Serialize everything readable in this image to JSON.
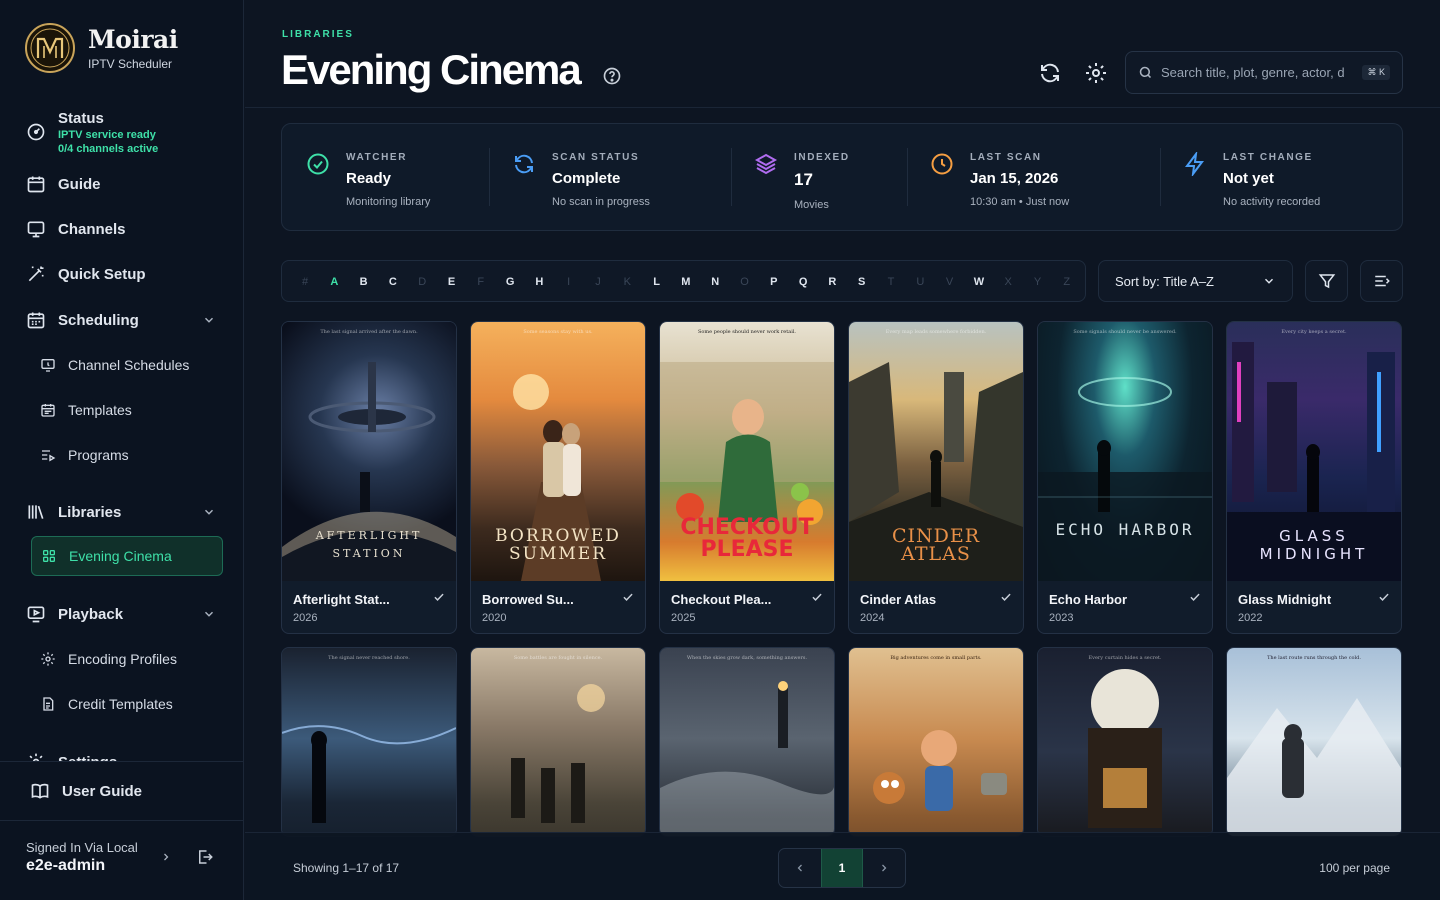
{
  "app": {
    "name": "Moirai",
    "subtitle": "IPTV Scheduler"
  },
  "colors": {
    "accent": "#3ee0a8",
    "background": "#0d1522",
    "sidebar": "#0b1320",
    "warning": "#f59e42",
    "purple": "#b06cf0",
    "blue": "#4a9df5"
  },
  "sidebar": {
    "status": {
      "title": "Status",
      "line1": "IPTV service ready",
      "line2": "0/4 channels active",
      "icon": "gauge-icon"
    },
    "guide": "Guide",
    "channels": "Channels",
    "quick_setup": "Quick Setup",
    "scheduling": "Scheduling",
    "channel_schedules": "Channel Schedules",
    "templates": "Templates",
    "programs": "Programs",
    "libraries": "Libraries",
    "evening_cinema": "Evening Cinema",
    "playback": "Playback",
    "encoding_profiles": "Encoding Profiles",
    "credit_templates": "Credit Templates",
    "settings": "Settings",
    "user_guide": "User Guide",
    "signed_label": "Signed In Via Local",
    "signed_user": "e2e-admin"
  },
  "header": {
    "eyebrow": "LIBRARIES",
    "title": "Evening Cinema",
    "search_placeholder": "Search title, plot, genre, actor, d",
    "search_shortcut": "⌘ K"
  },
  "stats": {
    "watcher": {
      "label": "WATCHER",
      "value": "Ready",
      "sub": "Monitoring library"
    },
    "scan": {
      "label": "SCAN STATUS",
      "value": "Complete",
      "sub": "No scan in progress"
    },
    "indexed": {
      "label": "INDEXED",
      "value": "17",
      "sub": "Movies"
    },
    "last_scan": {
      "label": "LAST SCAN",
      "value": "Jan 15, 2026",
      "sub": "10:30 am • Just now"
    },
    "last_change": {
      "label": "LAST CHANGE",
      "value": "Not yet",
      "sub": "No activity recorded"
    }
  },
  "alphabet": {
    "letters": [
      "#",
      "A",
      "B",
      "C",
      "D",
      "E",
      "F",
      "G",
      "H",
      "I",
      "J",
      "K",
      "L",
      "M",
      "N",
      "O",
      "P",
      "Q",
      "R",
      "S",
      "T",
      "U",
      "V",
      "W",
      "X",
      "Y",
      "Z"
    ],
    "enabled": [
      "A",
      "B",
      "C",
      "E",
      "G",
      "H",
      "L",
      "M",
      "N",
      "P",
      "Q",
      "R",
      "S",
      "W"
    ],
    "active": "A"
  },
  "sort": {
    "label": "Sort by: Title A–Z"
  },
  "movies": [
    {
      "title": "Afterlight Stat...",
      "year": "2026",
      "poster_title": "AFTERLIGHT STATION",
      "tagline": "The last signal arrived after the dawn."
    },
    {
      "title": "Borrowed Su...",
      "year": "2020",
      "poster_title": "BORROWED SUMMER",
      "tagline": "Some seasons stay with us."
    },
    {
      "title": "Checkout Plea...",
      "year": "2025",
      "poster_title": "CHECKOUT PLEASE",
      "tagline": "Some people should never work retail."
    },
    {
      "title": "Cinder Atlas",
      "year": "2024",
      "poster_title": "CINDER ATLAS",
      "tagline": "Every map leads somewhere forbidden."
    },
    {
      "title": "Echo Harbor",
      "year": "2023",
      "poster_title": "ECHO HARBOR",
      "tagline": "Some signals should never be answered."
    },
    {
      "title": "Glass Midnight",
      "year": "2022",
      "poster_title": "GLASS MIDNIGHT",
      "tagline": "Every city keeps a secret."
    }
  ],
  "movies_row2": [
    {
      "tagline": "The signal never reached shore."
    },
    {
      "tagline": "Some battles are fought in silence."
    },
    {
      "tagline": "When the skies grow dark, something answers."
    },
    {
      "tagline": "Big adventures come in small parts."
    },
    {
      "tagline": "Every curtain hides a secret."
    },
    {
      "tagline": "The last route runs through the cold."
    }
  ],
  "footer": {
    "showing": "Showing 1–17 of 17",
    "page": "1",
    "per_page": "100 per page"
  }
}
